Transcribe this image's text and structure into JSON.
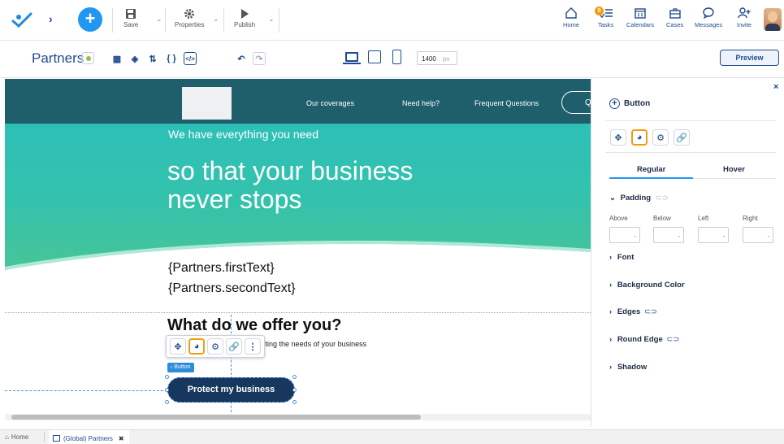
{
  "topbar": {
    "save_label": "Save",
    "properties_label": "Properties",
    "publish_label": "Publish",
    "right_items": [
      {
        "label": "Home",
        "icon": "home-icon"
      },
      {
        "label": "Tasks",
        "icon": "tasks-icon",
        "badge": "0"
      },
      {
        "label": "Calendars",
        "icon": "calendar-icon"
      },
      {
        "label": "Cases",
        "icon": "briefcase-icon"
      },
      {
        "label": "Messages",
        "icon": "chat-icon"
      },
      {
        "label": "Invite",
        "icon": "invite-icon"
      }
    ]
  },
  "toolbar": {
    "form_title": "Partners",
    "width_value": "1400",
    "width_unit": "px",
    "preview_label": "Preview"
  },
  "canvas": {
    "nav_links": [
      "Our coverages",
      "Need help?",
      "Frequent Questions"
    ],
    "nav_partial_button": "Q",
    "hero_small": "We have everything you need",
    "hero_big_1": "so that your business",
    "hero_big_2": "never stops",
    "first_text": "{Partners.firstText}",
    "second_text": "{Partners.secondText}",
    "offer_title": "What do we offer you?",
    "offer_sub": "ed on meeting the needs of your business",
    "button_tag": "‹ Button",
    "cta_label": "Protect my business"
  },
  "panel": {
    "close": "×",
    "title": "Button",
    "tabs": [
      "Regular",
      "Hover"
    ],
    "padding_label": "Padding",
    "padding_fields": [
      {
        "label": "Above",
        "value": "-"
      },
      {
        "label": "Below",
        "value": "-"
      },
      {
        "label": "Left",
        "value": "-"
      },
      {
        "label": "Right",
        "value": "-"
      }
    ],
    "sections": [
      "Font",
      "Background Color",
      "Edges",
      "Round Edge",
      "Shadow"
    ]
  },
  "statusbar": {
    "home_label": "Home",
    "tab_label": "(Global) Partners",
    "tab_close": "✖"
  },
  "colors": {
    "brand_blue": "#1e4b8f",
    "accent_orange": "#f39c12",
    "teal": "#2bbfbd",
    "navbar_dark": "#1f5f6b",
    "cta_navy": "#17375e",
    "add_button": "#2196f3"
  }
}
